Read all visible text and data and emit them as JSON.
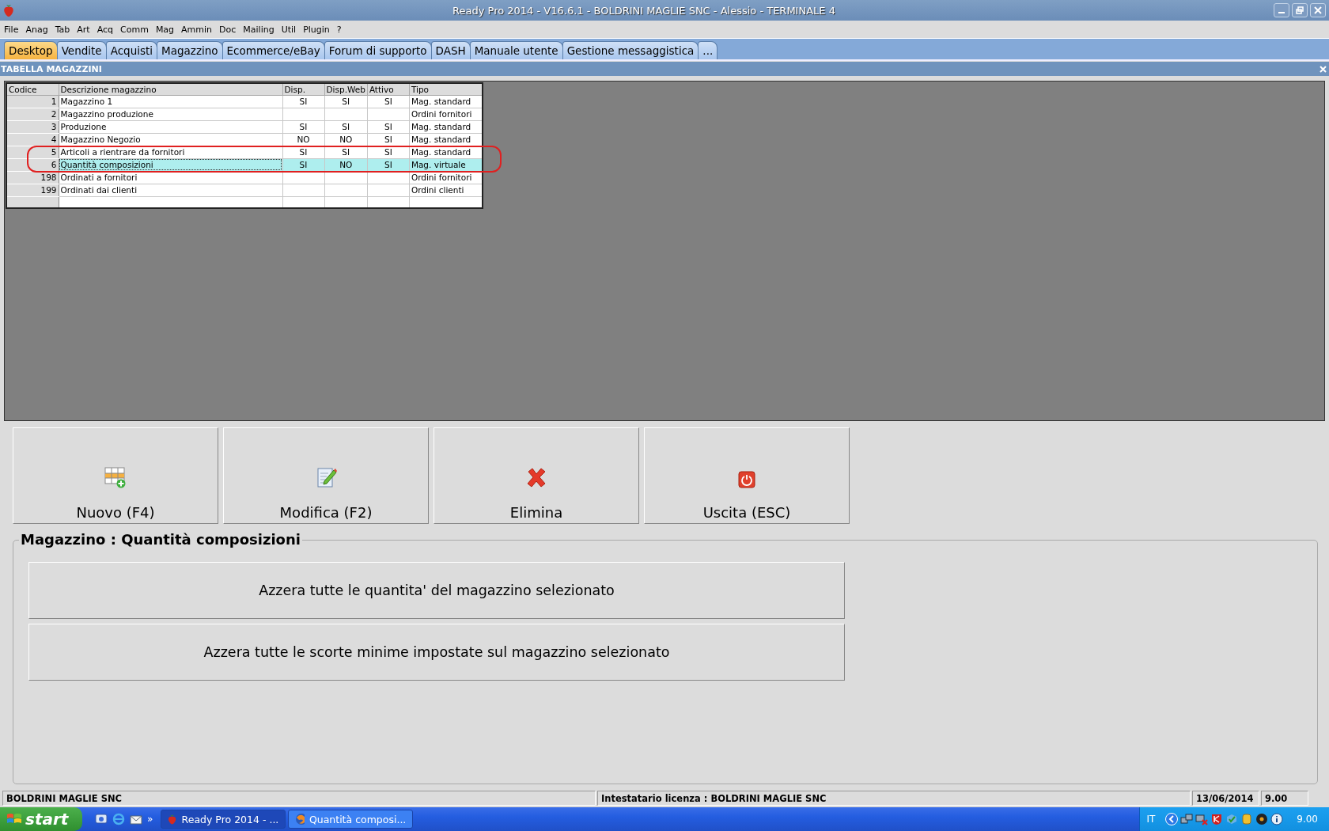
{
  "window": {
    "title": "Ready Pro 2014 - V16.6.1 - BOLDRINI MAGLIE SNC - Alessio - TERMINALE 4"
  },
  "menu": [
    "File",
    "Anag",
    "Tab",
    "Art",
    "Acq",
    "Comm",
    "Mag",
    "Ammin",
    "Doc",
    "Mailing",
    "Util",
    "Plugin",
    "?"
  ],
  "tabs": [
    {
      "label": "Desktop",
      "selected": true
    },
    {
      "label": "Vendite",
      "selected": false
    },
    {
      "label": "Acquisti",
      "selected": false
    },
    {
      "label": "Magazzino",
      "selected": false
    },
    {
      "label": "Ecommerce/eBay",
      "selected": false
    },
    {
      "label": "Forum di supporto",
      "selected": false
    },
    {
      "label": "DASH",
      "selected": false
    },
    {
      "label": "Manuale utente",
      "selected": false
    },
    {
      "label": "Gestione messaggistica",
      "selected": false
    },
    {
      "label": "...",
      "selected": false
    }
  ],
  "panel": {
    "title": "TABELLA MAGAZZINI"
  },
  "table": {
    "columns": [
      "Codice",
      "Descrizione magazzino",
      "Disp.",
      "Disp.Web",
      "Attivo",
      "Tipo"
    ],
    "rows": [
      {
        "cells": [
          "1",
          "Magazzino 1",
          "SI",
          "SI",
          "SI",
          "Mag. standard"
        ],
        "selected": false
      },
      {
        "cells": [
          "2",
          "Magazzino produzione",
          "",
          "",
          "",
          "Ordini fornitori"
        ],
        "selected": false
      },
      {
        "cells": [
          "3",
          "Produzione",
          "SI",
          "SI",
          "SI",
          "Mag. standard"
        ],
        "selected": false
      },
      {
        "cells": [
          "4",
          "Magazzino Negozio",
          "NO",
          "NO",
          "SI",
          "Mag. standard"
        ],
        "selected": false
      },
      {
        "cells": [
          "5",
          "Articoli a rientrare da fornitori",
          "SI",
          "SI",
          "SI",
          "Mag. standard"
        ],
        "selected": false
      },
      {
        "cells": [
          "6",
          "Quantità composizioni",
          "SI",
          "NO",
          "SI",
          "Mag. virtuale"
        ],
        "selected": true
      },
      {
        "cells": [
          "198",
          "Ordinati a fornitori",
          "",
          "",
          "",
          "Ordini fornitori"
        ],
        "selected": false
      },
      {
        "cells": [
          "199",
          "Ordinati dai clienti",
          "",
          "",
          "",
          "Ordini clienti"
        ],
        "selected": false
      }
    ]
  },
  "toolbar": [
    {
      "kind": "new",
      "label": "Nuovo (F4)"
    },
    {
      "kind": "edit",
      "label": "Modifica (F2)"
    },
    {
      "kind": "delete",
      "label": "Elimina"
    },
    {
      "kind": "exit",
      "label": "Uscita (ESC)"
    }
  ],
  "group": {
    "title": "Magazzino : Quantità composizioni",
    "actions": [
      "Azzera tutte le quantita' del magazzino selezionato",
      "Azzera tutte le scorte minime impostate sul magazzino selezionato"
    ]
  },
  "status_bar": [
    "BOLDRINI MAGLIE SNC",
    "Intestatario licenza : BOLDRINI MAGLIE SNC",
    "13/06/2014",
    "9.00"
  ],
  "taskbar": {
    "start": "start",
    "quicklaunch_more": "»",
    "tasks": [
      {
        "label": "Ready Pro 2014 - ...",
        "kind": "app",
        "selected": true
      },
      {
        "label": "Quantità composi...",
        "kind": "browser",
        "selected": false
      }
    ],
    "language": "IT",
    "clock": "9.00"
  }
}
